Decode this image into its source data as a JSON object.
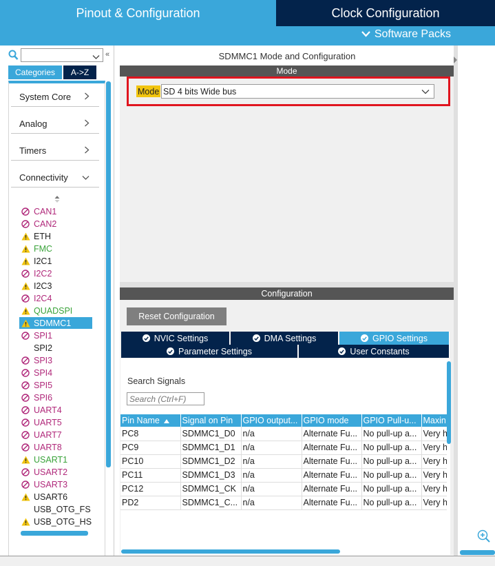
{
  "header": {
    "tab_pinout": "Pinout & Configuration",
    "tab_clock": "Clock Configuration",
    "software_packs": "Software Packs"
  },
  "sidebar": {
    "tabs": [
      "Categories",
      "A->Z"
    ],
    "categories": [
      {
        "label": "System Core",
        "chevron": "right"
      },
      {
        "label": "Analog",
        "chevron": "right"
      },
      {
        "label": "Timers",
        "chevron": "right"
      },
      {
        "label": "Connectivity",
        "chevron": "down"
      }
    ],
    "peripherals": [
      {
        "label": "CAN1",
        "status": "disabled",
        "color": "#b0287a"
      },
      {
        "label": "CAN2",
        "status": "disabled",
        "color": "#b0287a"
      },
      {
        "label": "ETH",
        "status": "warning",
        "color": "#222222"
      },
      {
        "label": "FMC",
        "status": "warning",
        "color": "#3aa33a"
      },
      {
        "label": "I2C1",
        "status": "warning",
        "color": "#222222"
      },
      {
        "label": "I2C2",
        "status": "disabled",
        "color": "#b0287a"
      },
      {
        "label": "I2C3",
        "status": "warning",
        "color": "#222222"
      },
      {
        "label": "I2C4",
        "status": "disabled",
        "color": "#b0287a"
      },
      {
        "label": "QUADSPI",
        "status": "warning",
        "color": "#3aa33a"
      },
      {
        "label": "SDMMC1",
        "status": "warning",
        "color": "#ffffff",
        "selected": true
      },
      {
        "label": "SPI1",
        "status": "disabled",
        "color": "#b0287a"
      },
      {
        "label": "SPI2",
        "status": "none",
        "color": "#222222"
      },
      {
        "label": "SPI3",
        "status": "disabled",
        "color": "#b0287a"
      },
      {
        "label": "SPI4",
        "status": "disabled",
        "color": "#b0287a"
      },
      {
        "label": "SPI5",
        "status": "disabled",
        "color": "#b0287a"
      },
      {
        "label": "SPI6",
        "status": "disabled",
        "color": "#b0287a"
      },
      {
        "label": "UART4",
        "status": "disabled",
        "color": "#b0287a"
      },
      {
        "label": "UART5",
        "status": "disabled",
        "color": "#b0287a"
      },
      {
        "label": "UART7",
        "status": "disabled",
        "color": "#b0287a"
      },
      {
        "label": "UART8",
        "status": "disabled",
        "color": "#b0287a"
      },
      {
        "label": "USART1",
        "status": "warning",
        "color": "#3aa33a"
      },
      {
        "label": "USART2",
        "status": "disabled",
        "color": "#b0287a"
      },
      {
        "label": "USART3",
        "status": "disabled",
        "color": "#b0287a"
      },
      {
        "label": "USART6",
        "status": "warning",
        "color": "#222222"
      },
      {
        "label": "USB_OTG_FS",
        "status": "none",
        "color": "#222222"
      },
      {
        "label": "USB_OTG_HS",
        "status": "warning",
        "color": "#222222"
      }
    ]
  },
  "mode": {
    "title": "SDMMC1 Mode and Configuration",
    "header": "Mode",
    "label": "Mode",
    "value": "SD 4 bits Wide bus"
  },
  "config": {
    "header": "Configuration",
    "reset_label": "Reset Configuration",
    "tabs_row1": [
      {
        "label": "NVIC Settings",
        "active": false
      },
      {
        "label": "DMA Settings",
        "active": false
      },
      {
        "label": "GPIO Settings",
        "active": true
      }
    ],
    "tabs_row2": [
      {
        "label": "Parameter Settings"
      },
      {
        "label": "User Constants"
      }
    ],
    "search_label": "Search Signals",
    "search_placeholder": "Search (Ctrl+F)",
    "table": {
      "headers": [
        "Pin Name",
        "Signal on Pin",
        "GPIO output...",
        "GPIO mode",
        "GPIO Pull-u...",
        "Maxin"
      ],
      "rows": [
        [
          "PC8",
          "SDMMC1_D0",
          "n/a",
          "Alternate Fu...",
          "No pull-up a...",
          "Very h"
        ],
        [
          "PC9",
          "SDMMC1_D1",
          "n/a",
          "Alternate Fu...",
          "No pull-up a...",
          "Very h"
        ],
        [
          "PC10",
          "SDMMC1_D2",
          "n/a",
          "Alternate Fu...",
          "No pull-up a...",
          "Very h"
        ],
        [
          "PC11",
          "SDMMC1_D3",
          "n/a",
          "Alternate Fu...",
          "No pull-up a...",
          "Very h"
        ],
        [
          "PC12",
          "SDMMC1_CK",
          "n/a",
          "Alternate Fu...",
          "No pull-up a...",
          "Very h"
        ],
        [
          "PD2",
          "SDMMC1_C...",
          "n/a",
          "Alternate Fu...",
          "No pull-up a...",
          "Very h"
        ]
      ]
    }
  },
  "colors": {
    "accent": "#3aa7da",
    "navy": "#03234b",
    "highlight_red": "#e0141e",
    "mode_label_yellow": "#f1c40f"
  }
}
